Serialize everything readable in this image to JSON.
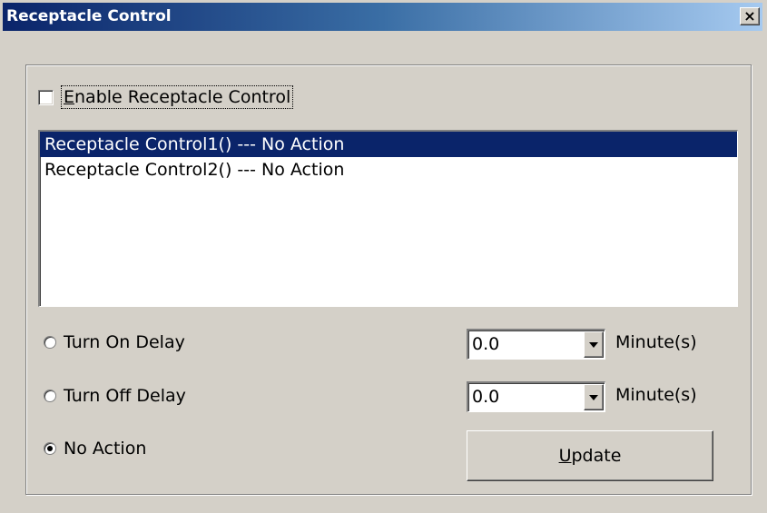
{
  "window": {
    "title": "Receptacle Control",
    "close_glyph": "×"
  },
  "enable_checkbox": {
    "label": "Enable Receptacle Control",
    "checked": false
  },
  "list": {
    "items": [
      {
        "label": "Receptacle Control1() --- No Action",
        "selected": true
      },
      {
        "label": "Receptacle Control2() --- No Action",
        "selected": false
      }
    ]
  },
  "options": {
    "turn_on": {
      "label": "Turn On Delay",
      "checked": false,
      "value": "0.0",
      "unit": "Minute(s)"
    },
    "turn_off": {
      "label": "Turn Off Delay",
      "checked": false,
      "value": "0.0",
      "unit": "Minute(s)"
    },
    "no_action": {
      "label": "No Action",
      "checked": true
    }
  },
  "update_button": {
    "label": "Update"
  },
  "colors": {
    "face": "#d4d0c8",
    "titlebar_start": "#0a246a",
    "titlebar_end": "#a6caf0",
    "selection": "#0a246a"
  }
}
